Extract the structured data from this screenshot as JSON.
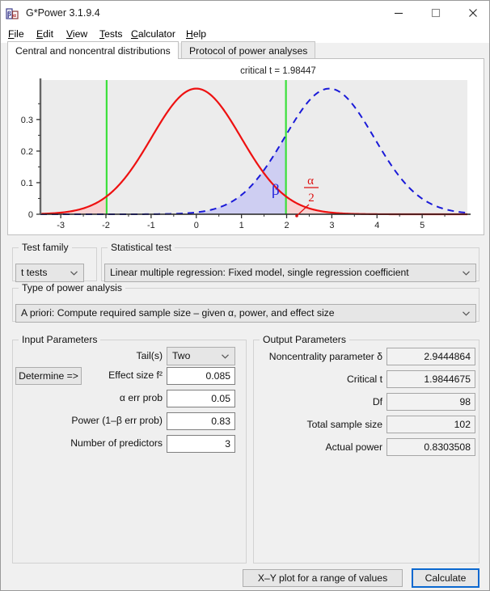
{
  "window": {
    "title": "G*Power 3.1.9.4",
    "icon": "gpower-app-icon",
    "minimize_label": "Minimize",
    "maximize_label": "Maximize",
    "close_label": "Close"
  },
  "menu": [
    {
      "label": "File",
      "mnemonic": "F"
    },
    {
      "label": "Edit",
      "mnemonic": "E"
    },
    {
      "label": "View",
      "mnemonic": "V"
    },
    {
      "label": "Tests",
      "mnemonic": "T"
    },
    {
      "label": "Calculator",
      "mnemonic": "C"
    },
    {
      "label": "Help",
      "mnemonic": "H"
    }
  ],
  "tabs": [
    {
      "label": "Central and noncentral distributions",
      "active": true
    },
    {
      "label": "Protocol of power analyses",
      "active": false
    }
  ],
  "chart_data": {
    "type": "line",
    "title": "critical t = 1.98447",
    "xlabel": "",
    "ylabel": "",
    "xlim": [
      -3.45,
      6.0
    ],
    "ylim": [
      0,
      0.425
    ],
    "xticks": [
      -3,
      -2,
      -1,
      0,
      1,
      2,
      3,
      4,
      5
    ],
    "xticklabels": [
      "-3",
      "-2",
      "-1",
      "0",
      "1",
      "2",
      "3",
      "4",
      "5"
    ],
    "yticks": [
      0,
      0.1,
      0.2,
      0.3
    ],
    "yticklabels": [
      "0",
      "0.1",
      "0.2",
      "0.3"
    ],
    "grid": false,
    "plot_bg": "#ececec",
    "series": [
      {
        "name": "central t distribution (H0)",
        "color": "#ee1111",
        "style": "solid",
        "center": 0,
        "df": 98,
        "ncp": 0
      },
      {
        "name": "noncentral t distribution (H1)",
        "color": "#1a1ad8",
        "style": "dashed",
        "center": 2.9444864,
        "df": 98,
        "ncp": 2.9444864
      }
    ],
    "critical_lines": [
      {
        "value": -1.98447,
        "color": "#3be03b"
      },
      {
        "value": 1.98447,
        "color": "#3be03b"
      }
    ],
    "annotations": [
      {
        "text": "critical t = 1.98447",
        "color": "#222222",
        "at": "top-center"
      },
      {
        "text": "β",
        "color": "#2020dd",
        "at": "x=1.62, y=0.085"
      },
      {
        "text": "α",
        "color": "#dd1111",
        "at": "x=2.42, y=0.135"
      },
      {
        "text": "2",
        "color": "#dd1111",
        "at": "x=2.42, y=0.098"
      }
    ],
    "shaded_regions": [
      {
        "name": "alpha/2 right tail",
        "fill": "#f8d2d2",
        "from": 1.98447,
        "to": 6.0
      },
      {
        "name": "alpha/2 left tail",
        "fill": "#f8d2d2",
        "from": -3.45,
        "to": -1.98447
      },
      {
        "name": "beta region",
        "fill": "#ccccf2",
        "from": -3.45,
        "to": 1.98447
      }
    ]
  },
  "test_family": {
    "group_title": "Test family",
    "value": "t tests"
  },
  "statistical_test": {
    "group_title": "Statistical test",
    "value": "Linear multiple regression: Fixed model, single regression coefficient"
  },
  "power_analysis_type": {
    "group_title": "Type of power analysis",
    "value": "A priori: Compute required sample size – given α, power, and effect size"
  },
  "input_parameters": {
    "group_title": "Input Parameters",
    "determine_button": "Determine =>",
    "rows": [
      {
        "label": "Tail(s)",
        "value": "Two",
        "kind": "combo"
      },
      {
        "label": "Effect size f²",
        "value": "0.085",
        "kind": "text"
      },
      {
        "label": "α err prob",
        "value": "0.05",
        "kind": "text"
      },
      {
        "label": "Power (1–β err prob)",
        "value": "0.83",
        "kind": "text"
      },
      {
        "label": "Number of predictors",
        "value": "3",
        "kind": "text"
      }
    ]
  },
  "output_parameters": {
    "group_title": "Output Parameters",
    "rows": [
      {
        "label": "Noncentrality parameter δ",
        "value": "2.9444864"
      },
      {
        "label": "Critical t",
        "value": "1.9844675"
      },
      {
        "label": "Df",
        "value": "98"
      },
      {
        "label": "Total sample size",
        "value": "102"
      },
      {
        "label": "Actual power",
        "value": "0.8303508"
      }
    ]
  },
  "footer": {
    "xy_plot_button": "X–Y plot for a range of values",
    "calculate_button": "Calculate"
  },
  "colors": {
    "accent": "#0a68d0",
    "h0_curve": "#ee1111",
    "h1_curve": "#1a1ad8",
    "critical_line": "#3be03b",
    "beta_fill": "#ccccf2",
    "alpha_fill": "#f8d2d2"
  }
}
